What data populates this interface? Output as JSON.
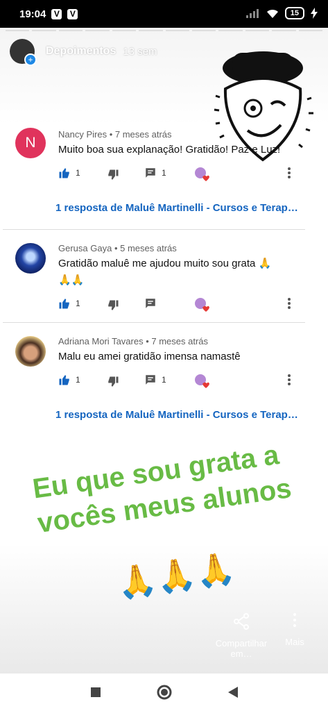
{
  "status_bar": {
    "time": "19:04",
    "badges": [
      "V",
      "V"
    ],
    "battery": "15"
  },
  "story": {
    "title": "Depoimentos",
    "age": "13 sem"
  },
  "comments": [
    {
      "author": "Nancy Pires",
      "when": "7 meses atrás",
      "text": "Muito boa sua explanação! Gratidão! Paz e Luz!",
      "avatar_letter": "N",
      "likes": "1",
      "replies_count": "1",
      "reply_link": "1 resposta de Maluê Martinelli - Cursos e Terap…"
    },
    {
      "author": "Gerusa Gaya",
      "when": "5 meses atrás",
      "text_line1": "Gratidão maluê me ajudou muito sou grata 🙏",
      "text_line2": "🙏🙏",
      "likes": "1"
    },
    {
      "author": "Adriana Mori Tavares",
      "when": "7 meses atrás",
      "text": "Malu eu amei gratidão imensa namastê",
      "likes": "1",
      "replies_count": "1",
      "reply_link": "1 resposta de Maluê Martinelli - Cursos e Terap…"
    }
  ],
  "overlay": {
    "line1": "Eu que sou grata a",
    "line2": "vocês meus alunos",
    "emojis": "🙏🙏🙏"
  },
  "footer": {
    "share_label": "Compartilhar em…",
    "more_label": "Mais"
  },
  "colors": {
    "accent_blue": "#1565c0",
    "overlay_green": "#68bb45",
    "avatar_n": "#e0335c"
  }
}
